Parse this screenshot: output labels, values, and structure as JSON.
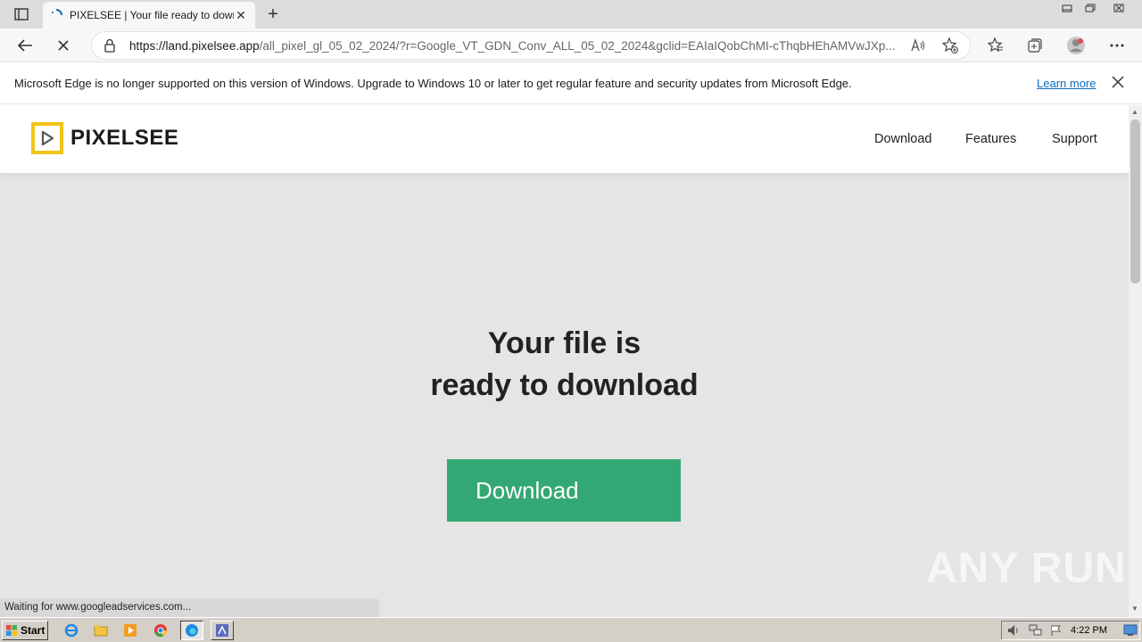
{
  "browser": {
    "tab_title": "PIXELSEE | Your file ready to download",
    "tab_close": "✕",
    "new_tab": "+",
    "url_host": "https://land.pixelsee.app",
    "url_path": "/all_pixel_gl_05_02_2024/?r=Google_VT_GDN_Conv_ALL_05_02_2024&gclid=EAIaIQobChMI-cThqbHEhAMVwJXp...",
    "infobar_message": "Microsoft Edge is no longer supported on this version of Windows. Upgrade to Windows 10 or later to get regular feature and security updates from Microsoft Edge.",
    "infobar_link": "Learn more",
    "status_text": "Waiting for www.googleadservices.com..."
  },
  "site": {
    "logo_text": "PIXELSEE",
    "nav": [
      "Download",
      "Features",
      "Support"
    ],
    "hero_line1": "Your file is",
    "hero_line2": "ready to download",
    "download_button": "Download",
    "watermark": "ANY RUN"
  },
  "taskbar": {
    "start_label": "Start",
    "clock": "4:22 PM"
  },
  "colors": {
    "accent_green": "#34a874",
    "logo_yellow": "#f0c419",
    "link_blue": "#0f6cbd"
  }
}
